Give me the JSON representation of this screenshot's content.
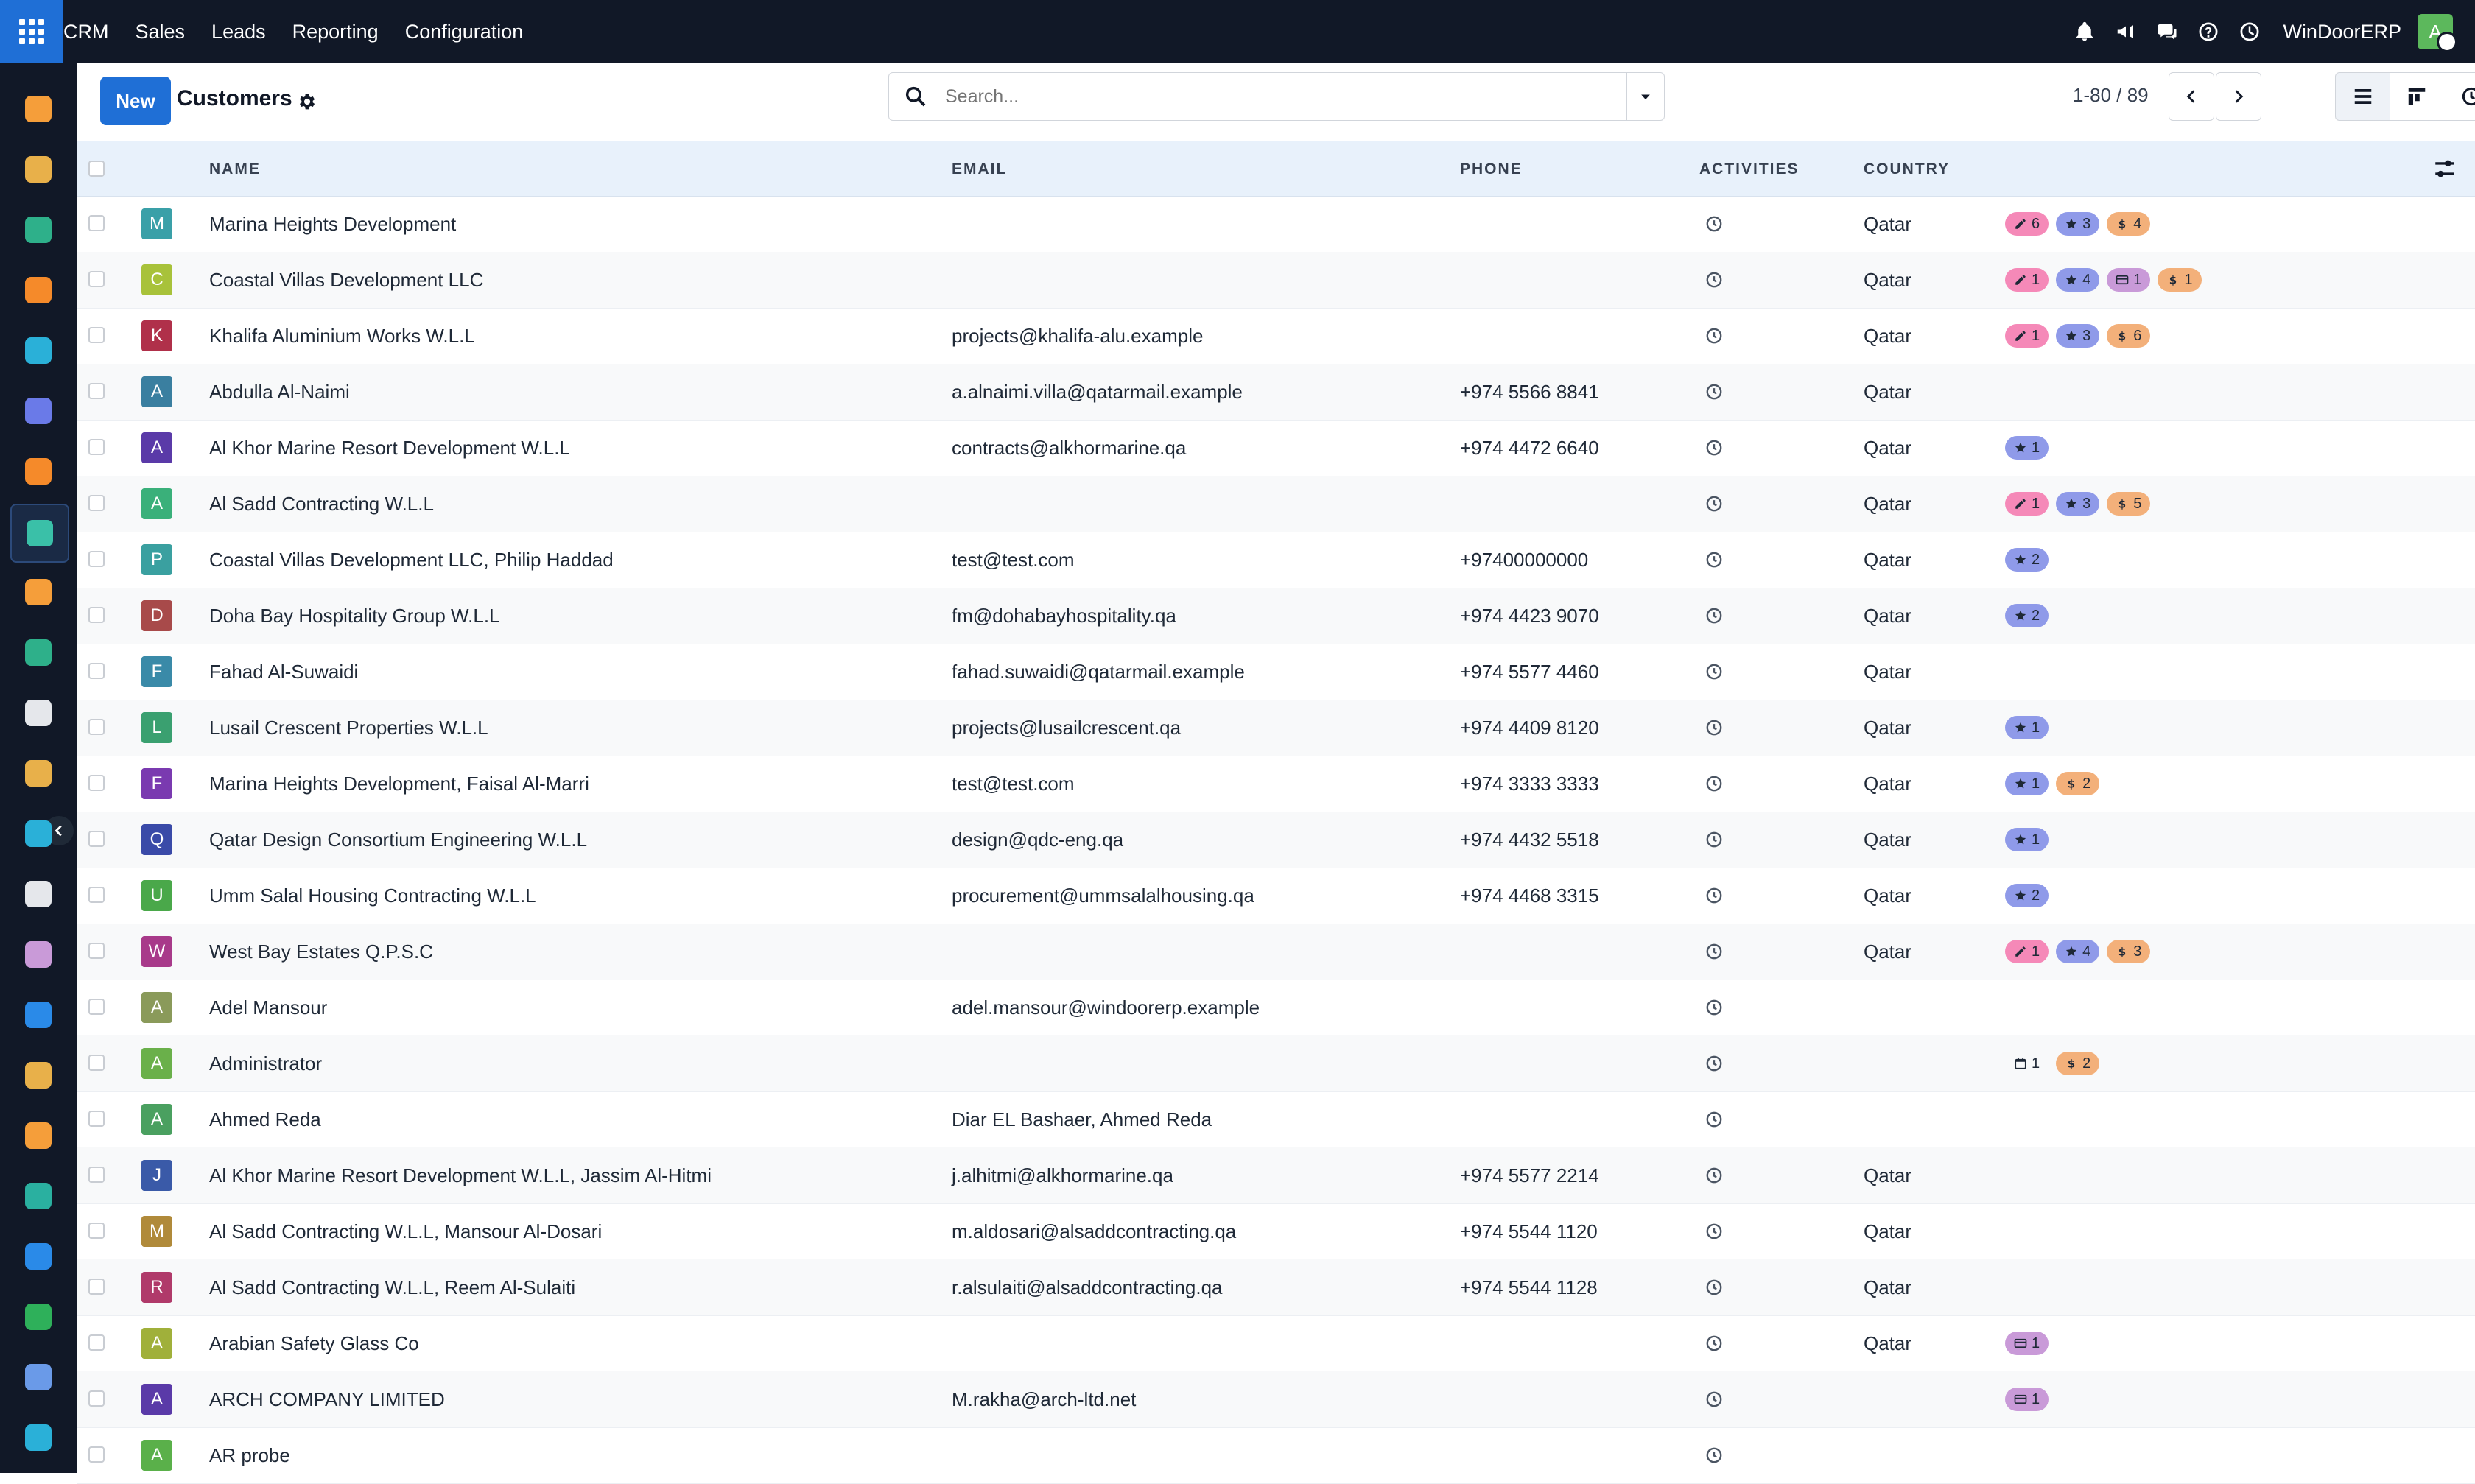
{
  "topbar": {
    "brand": "CRM",
    "menu": [
      "Sales",
      "Leads",
      "Reporting",
      "Configuration"
    ],
    "company": "WinDoorERP",
    "user_initial": "A"
  },
  "control": {
    "new_label": "New",
    "title": "Customers",
    "search_placeholder": "Search...",
    "pager": "1-80 / 89"
  },
  "columns": {
    "name": "NAME",
    "email": "EMAIL",
    "phone": "PHONE",
    "activities": "ACTIVITIES",
    "country": "COUNTRY"
  },
  "colors": {
    "accent": "#1f6fd6",
    "topbar": "#111827",
    "tag_edit": "#f589b8",
    "tag_star": "#8f9ae9",
    "tag_dollar": "#f3b07a",
    "tag_card": "#c99ad8",
    "tag_calendar": "#f5d77a"
  },
  "rows": [
    {
      "initial": "M",
      "avatar_color": "#3aa0a8",
      "name": "Marina Heights Development",
      "email": "",
      "phone": "",
      "country": "Qatar",
      "tags": [
        {
          "icon": "edit",
          "count": "6"
        },
        {
          "icon": "star",
          "count": "3"
        },
        {
          "icon": "dollar",
          "count": "4"
        }
      ]
    },
    {
      "initial": "C",
      "avatar_color": "#a8c23a",
      "name": "Coastal Villas Development LLC",
      "email": "",
      "phone": "",
      "country": "Qatar",
      "tags": [
        {
          "icon": "edit",
          "count": "1"
        },
        {
          "icon": "star",
          "count": "4"
        },
        {
          "icon": "card",
          "count": "1"
        },
        {
          "icon": "dollar",
          "count": "1"
        }
      ]
    },
    {
      "initial": "K",
      "avatar_color": "#b0304a",
      "name": "Khalifa Aluminium Works W.L.L",
      "email": "projects@khalifa-alu.example",
      "phone": "",
      "country": "Qatar",
      "tags": [
        {
          "icon": "edit",
          "count": "1"
        },
        {
          "icon": "star",
          "count": "3"
        },
        {
          "icon": "dollar",
          "count": "6"
        }
      ]
    },
    {
      "initial": "A",
      "avatar_color": "#3a7fa0",
      "name": "Abdulla Al-Naimi",
      "email": "a.alnaimi.villa@qatarmail.example",
      "phone": "+974 5566 8841",
      "country": "Qatar",
      "tags": []
    },
    {
      "initial": "A",
      "avatar_color": "#5a3aa8",
      "name": "Al Khor Marine Resort Development W.L.L",
      "email": "contracts@alkhormarine.qa",
      "phone": "+974 4472 6640",
      "country": "Qatar",
      "tags": [
        {
          "icon": "star",
          "count": "1"
        }
      ]
    },
    {
      "initial": "A",
      "avatar_color": "#3ab07a",
      "name": "Al Sadd Contracting W.L.L",
      "email": "",
      "phone": "",
      "country": "Qatar",
      "tags": [
        {
          "icon": "edit",
          "count": "1"
        },
        {
          "icon": "star",
          "count": "3"
        },
        {
          "icon": "dollar",
          "count": "5"
        }
      ]
    },
    {
      "initial": "P",
      "avatar_color": "#3aa0a0",
      "name": "Coastal Villas Development LLC, Philip Haddad",
      "email": "test@test.com",
      "phone": "+97400000000",
      "country": "Qatar",
      "tags": [
        {
          "icon": "star",
          "count": "2"
        }
      ]
    },
    {
      "initial": "D",
      "avatar_color": "#a84a4a",
      "name": "Doha Bay Hospitality Group W.L.L",
      "email": "fm@dohabayhospitality.qa",
      "phone": "+974 4423 9070",
      "country": "Qatar",
      "tags": [
        {
          "icon": "star",
          "count": "2"
        }
      ]
    },
    {
      "initial": "F",
      "avatar_color": "#3a8aa8",
      "name": "Fahad Al-Suwaidi",
      "email": "fahad.suwaidi@qatarmail.example",
      "phone": "+974 5577 4460",
      "country": "Qatar",
      "tags": []
    },
    {
      "initial": "L",
      "avatar_color": "#3aa070",
      "name": "Lusail Crescent Properties W.L.L",
      "email": "projects@lusailcrescent.qa",
      "phone": "+974 4409 8120",
      "country": "Qatar",
      "tags": [
        {
          "icon": "star",
          "count": "1"
        }
      ]
    },
    {
      "initial": "F",
      "avatar_color": "#7a3ab0",
      "name": "Marina Heights Development, Faisal Al-Marri",
      "email": "test@test.com",
      "phone": "+974 3333 3333",
      "country": "Qatar",
      "tags": [
        {
          "icon": "star",
          "count": "1"
        },
        {
          "icon": "dollar",
          "count": "2"
        }
      ]
    },
    {
      "initial": "Q",
      "avatar_color": "#3a4aa8",
      "name": "Qatar Design Consortium Engineering W.L.L",
      "email": "design@qdc-eng.qa",
      "phone": "+974 4432 5518",
      "country": "Qatar",
      "tags": [
        {
          "icon": "star",
          "count": "1"
        }
      ]
    },
    {
      "initial": "U",
      "avatar_color": "#4aa84a",
      "name": "Umm Salal Housing Contracting W.L.L",
      "email": "procurement@ummsalalhousing.qa",
      "phone": "+974 4468 3315",
      "country": "Qatar",
      "tags": [
        {
          "icon": "star",
          "count": "2"
        }
      ]
    },
    {
      "initial": "W",
      "avatar_color": "#a83a8a",
      "name": "West Bay Estates Q.P.S.C",
      "email": "",
      "phone": "",
      "country": "Qatar",
      "tags": [
        {
          "icon": "edit",
          "count": "1"
        },
        {
          "icon": "star",
          "count": "4"
        },
        {
          "icon": "dollar",
          "count": "3"
        }
      ]
    },
    {
      "initial": "A",
      "avatar_color": "#8a9a5a",
      "name": "Adel Mansour",
      "email": "adel.mansour@windoorerp.example",
      "phone": "",
      "country": "",
      "tags": []
    },
    {
      "initial": "A",
      "avatar_color": "#6ab04a",
      "name": "Administrator",
      "email": "",
      "phone": "",
      "country": "",
      "tags": [
        {
          "icon": "calendar",
          "count": "1"
        },
        {
          "icon": "dollar",
          "count": "2"
        }
      ]
    },
    {
      "initial": "A",
      "avatar_color": "#4aa060",
      "name": "Ahmed Reda",
      "email": "Diar EL Bashaer, Ahmed Reda",
      "phone": "",
      "country": "",
      "tags": []
    },
    {
      "initial": "J",
      "avatar_color": "#3a5aa8",
      "name": "Al Khor Marine Resort Development W.L.L, Jassim Al-Hitmi",
      "email": "j.alhitmi@alkhormarine.qa",
      "phone": "+974 5577 2214",
      "country": "Qatar",
      "tags": []
    },
    {
      "initial": "M",
      "avatar_color": "#b08a3a",
      "name": "Al Sadd Contracting W.L.L, Mansour Al-Dosari",
      "email": "m.aldosari@alsaddcontracting.qa",
      "phone": "+974 5544 1120",
      "country": "Qatar",
      "tags": []
    },
    {
      "initial": "R",
      "avatar_color": "#b03a6a",
      "name": "Al Sadd Contracting W.L.L, Reem Al-Sulaiti",
      "email": "r.alsulaiti@alsaddcontracting.qa",
      "phone": "+974 5544 1128",
      "country": "Qatar",
      "tags": []
    },
    {
      "initial": "A",
      "avatar_color": "#a0b03a",
      "name": "Arabian Safety Glass Co",
      "email": "",
      "phone": "",
      "country": "Qatar",
      "tags": [
        {
          "icon": "card",
          "count": "1"
        }
      ]
    },
    {
      "initial": "A",
      "avatar_color": "#5a3aa8",
      "name": "ARCH COMPANY LIMITED",
      "email": "M.rakha@arch-ltd.net",
      "phone": "",
      "country": "",
      "tags": [
        {
          "icon": "card",
          "count": "1"
        }
      ]
    },
    {
      "initial": "A",
      "avatar_color": "#5ab04a",
      "name": "AR probe",
      "email": "",
      "phone": "",
      "country": "",
      "tags": []
    }
  ],
  "left_apps": [
    {
      "name": "app-sales-icon",
      "color": "#f59e3a"
    },
    {
      "name": "app-product-icon",
      "color": "#e8b04a"
    },
    {
      "name": "app-contacts-icon",
      "color": "#2eb08a"
    },
    {
      "name": "app-discuss-icon",
      "color": "#f58a2a"
    },
    {
      "name": "app-website-icon",
      "color": "#2ab0d8"
    },
    {
      "name": "app-mail-icon",
      "color": "#6a7ae8"
    },
    {
      "name": "app-chat-icon",
      "color": "#f58a2a"
    },
    {
      "name": "app-crm-icon",
      "color": "#3ac0a8"
    },
    {
      "name": "app-reporting-icon",
      "color": "#f59e3a"
    },
    {
      "name": "app-employees-icon",
      "color": "#2eb08a"
    },
    {
      "name": "app-inventory-icon",
      "color": "#e5e7eb"
    },
    {
      "name": "app-studio-icon",
      "color": "#e8b04a"
    },
    {
      "name": "app-project-icon",
      "color": "#2ab0d8"
    },
    {
      "name": "app-knowledge-icon",
      "color": "#e5e7eb"
    },
    {
      "name": "app-purchase-icon",
      "color": "#c99ad8"
    },
    {
      "name": "app-invoicing-icon",
      "color": "#2a8ae8"
    },
    {
      "name": "app-team-icon",
      "color": "#e8b04a"
    },
    {
      "name": "app-calendar-icon",
      "color": "#f59e3a"
    },
    {
      "name": "app-sign-icon",
      "color": "#2ab0a0"
    },
    {
      "name": "app-dashboard-icon",
      "color": "#2a8ae8"
    },
    {
      "name": "app-whatsapp-icon",
      "color": "#2eb05a"
    },
    {
      "name": "app-timesheet-icon",
      "color": "#6a9ae8"
    },
    {
      "name": "app-helpdesk-icon",
      "color": "#2ab0d8"
    }
  ]
}
